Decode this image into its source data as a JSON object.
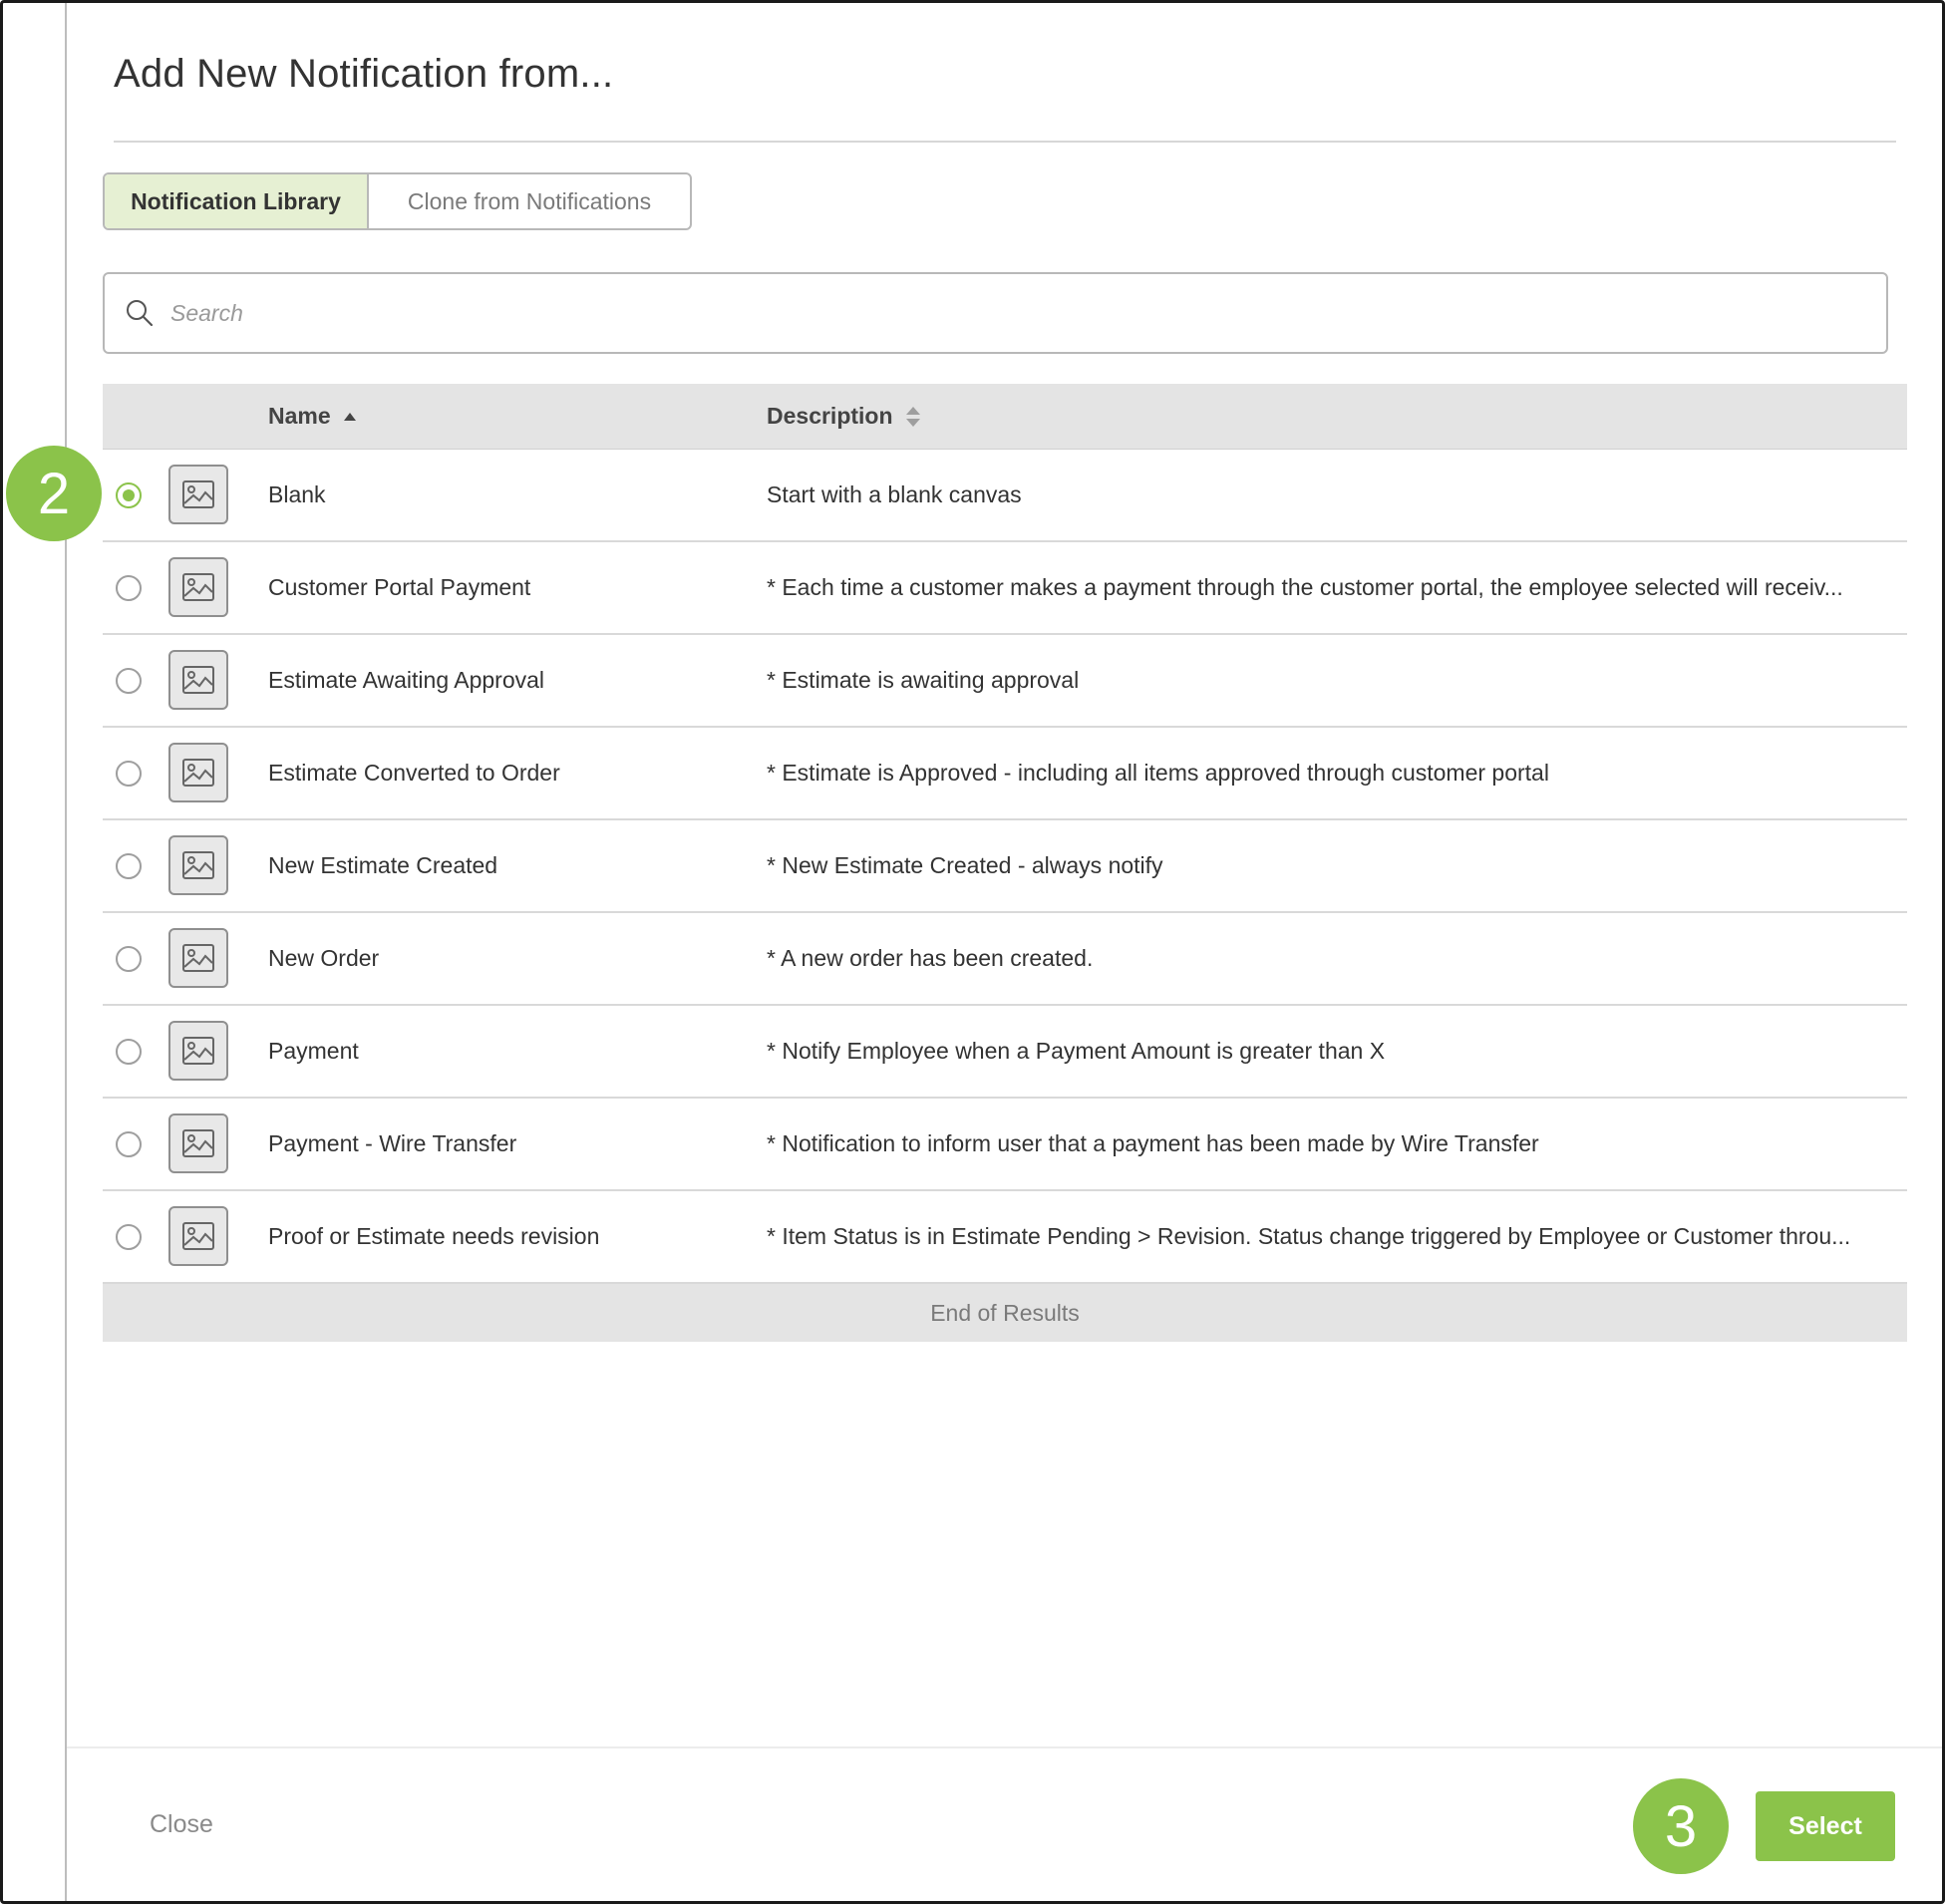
{
  "dialog": {
    "title": "Add New Notification from..."
  },
  "tabs": [
    {
      "label": "Notification Library",
      "active": true
    },
    {
      "label": "Clone from Notifications",
      "active": false
    }
  ],
  "search": {
    "placeholder": "Search",
    "value": ""
  },
  "table": {
    "columns": [
      {
        "label": "Name",
        "sort": "ascending"
      },
      {
        "label": "Description",
        "sort": "none"
      }
    ],
    "rows": [
      {
        "name": "Blank",
        "description": "Start with a blank canvas",
        "selected": true,
        "icon": "image-placeholder-icon"
      },
      {
        "name": "Customer Portal Payment",
        "description": "* Each time a customer makes a payment through the customer portal, the employee selected will receiv...",
        "selected": false,
        "icon": "image-placeholder-icon"
      },
      {
        "name": "Estimate Awaiting Approval",
        "description": "* Estimate is awaiting approval",
        "selected": false,
        "icon": "image-placeholder-icon"
      },
      {
        "name": "Estimate Converted to Order",
        "description": "* Estimate is Approved - including all items approved through customer portal",
        "selected": false,
        "icon": "image-placeholder-icon"
      },
      {
        "name": "New Estimate Created",
        "description": "* New Estimate Created - always notify",
        "selected": false,
        "icon": "image-placeholder-icon"
      },
      {
        "name": "New Order",
        "description": "* A new order has been created.",
        "selected": false,
        "icon": "image-placeholder-icon"
      },
      {
        "name": "Payment",
        "description": "* Notify Employee when a Payment Amount is greater than X",
        "selected": false,
        "icon": "image-placeholder-icon"
      },
      {
        "name": "Payment - Wire Transfer",
        "description": "* Notification to inform user that a payment has been made by Wire Transfer",
        "selected": false,
        "icon": "image-placeholder-icon"
      },
      {
        "name": "Proof or Estimate needs revision",
        "description": "* Item Status is in Estimate Pending > Revision. Status change triggered by Employee or Customer throu...",
        "selected": false,
        "icon": "image-placeholder-icon"
      }
    ],
    "end_text": "End of Results"
  },
  "footer": {
    "close_label": "Close",
    "select_label": "Select"
  },
  "annotations": {
    "step_2": "2",
    "step_3": "3"
  },
  "colors": {
    "accent": "#8bc34a",
    "active_tab_bg": "#e6f0d3",
    "header_bg": "#e4e4e4"
  }
}
